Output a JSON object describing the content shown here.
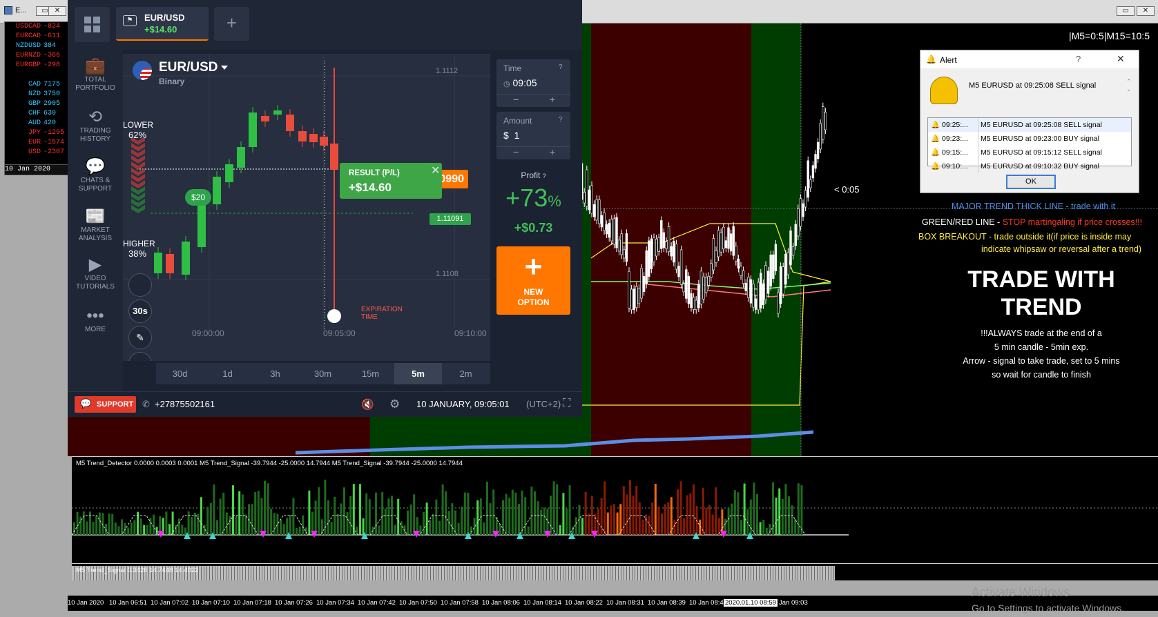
{
  "window": {
    "title": "E...",
    "minimize": "▭",
    "close": "✕"
  },
  "main_window": {
    "minimize": "▭",
    "close": "✕"
  },
  "market_watch": {
    "rows": [
      {
        "sym": "USDCAD",
        "val": "-824",
        "color": "#ff3030"
      },
      {
        "sym": "EURCAD",
        "val": "-611",
        "color": "#ff3030"
      },
      {
        "sym": "NZDUSD",
        "val": "384",
        "color": "#35c6ff"
      },
      {
        "sym": "EURNZD",
        "val": "-366",
        "color": "#ff3030"
      },
      {
        "sym": "EURGBP",
        "val": "-298",
        "color": "#ff3030"
      },
      {
        "sym": "",
        "val": "",
        "color": "#000000"
      },
      {
        "sym": "CAD",
        "val": "7175",
        "color": "#35c6ff"
      },
      {
        "sym": "NZD",
        "val": "3750",
        "color": "#35c6ff"
      },
      {
        "sym": "GBP",
        "val": "2905",
        "color": "#35c6ff"
      },
      {
        "sym": "CHF",
        "val": "630",
        "color": "#35c6ff"
      },
      {
        "sym": "AUD",
        "val": "420",
        "color": "#35c6ff"
      },
      {
        "sym": "JPY",
        "val": "-1295",
        "color": "#ff3030"
      },
      {
        "sym": "EUR",
        "val": "-1574",
        "color": "#ff3030"
      },
      {
        "sym": "USD",
        "val": "-2307",
        "color": "#ff3030"
      }
    ],
    "footer": "10 Jan 2020",
    "footer2": "10 Ja"
  },
  "chart": {
    "corner_text": "|M5=0:5|M15=10:5",
    "countdown": "< 0:05",
    "legend": [
      {
        "text": "MAJOR TREND THICK LINE  -  trade with it",
        "color": "#4f8fe6"
      },
      {
        "text": "GREEN/RED LINE - ",
        "color": "#ffffff"
      },
      {
        "text": "STOP martingaling if price crosses!!!",
        "color": "#ff3b1f"
      },
      {
        "text": "BOX BREAKOUT - trade outside it(if price is inside may",
        "color": "#ffee3a"
      },
      {
        "text": "indicate whipsaw or reversal after a trend)",
        "color": "#ffee3a"
      }
    ],
    "big_title_1": "TRADE WITH",
    "big_title_2": "TREND",
    "notes": [
      "!!!ALWAYS trade at the end of a",
      "5 min candle - 5min exp.",
      "Arrow - signal to take trade, set to 5 mins",
      "so wait for candle to finish"
    ],
    "indicator_label": "M5 Trend_Detector 0.0000 0.0003 0.0001  M5 Trend_Signal -39.7944 -25.0000 14.7944  M5 Trend_Signal -39.7944 -25.0000 14.7944",
    "indicator2_label": "M5 Trend_Signal 0.3426 14.7448 14.4022",
    "time_axis": [
      "10 Jan 2020",
      "10 Jan 06:51",
      "10 Jan 07:02",
      "10 Jan 07:10",
      "10 Jan 07:18",
      "10 Jan 07:26",
      "10 Jan 07:34",
      "10 Jan 07:42",
      "10 Jan 07:50",
      "10 Jan 07:58",
      "10 Jan 08:06",
      "10 Jan 08:14",
      "10 Jan 08:22",
      "10 Jan 08:31",
      "10 Jan 08:39",
      "10 Jan 08:47",
      "2020.01.10 08:59",
      "Jan 09:03"
    ],
    "watermark_1": "Activate Windows",
    "watermark_2": "Go to Settings to activate Windows."
  },
  "alert": {
    "title": "Alert",
    "help": "?",
    "close": "✕",
    "message": "M5 EURUSD at 09:25:08  SELL signal",
    "rows": [
      {
        "time": "09:25:...",
        "msg": "M5 EURUSD at 09:25:08  SELL signal"
      },
      {
        "time": "09:23:...",
        "msg": "M5 EURUSD at 09:23:00  BUY signal"
      },
      {
        "time": "09:15:...",
        "msg": "M5 EURUSD at 09:15:12  SELL signal"
      },
      {
        "time": "09:10:...",
        "msg": "M5 EURUSD at 09:10:32  BUY signal"
      }
    ],
    "ok": "OK"
  },
  "iq": {
    "tab_asset": "EUR/USD",
    "tab_pl": "+$14.60",
    "add_tab": "+",
    "sidebar": [
      {
        "label1": "TOTAL",
        "label2": "PORTFOLIO",
        "icon": "briefcase-icon"
      },
      {
        "label1": "TRADING",
        "label2": "HISTORY",
        "icon": "history-icon"
      },
      {
        "label1": "CHATS &",
        "label2": "SUPPORT",
        "icon": "chat-icon"
      },
      {
        "label1": "MARKET",
        "label2": "ANALYSIS",
        "icon": "news-icon"
      },
      {
        "label1": "VIDEO",
        "label2": "TUTORIALS",
        "icon": "play-icon"
      },
      {
        "label1": "MORE",
        "label2": "",
        "icon": "more-icon"
      }
    ],
    "asset": "EUR/USD",
    "asset_type": "Binary",
    "lower_label": "LOWER",
    "lower_pct": "62%",
    "higher_label": "HIGHER",
    "higher_pct": "38%",
    "price_ticks": [
      "1.1112",
      "1.1108"
    ],
    "current_price": "1.11091",
    "result_price": "1.10990",
    "result_price_visible": "0990",
    "result_label": "RESULT (P/L)",
    "result_value": "+$14.60",
    "bet_label": "$20",
    "time_ticks": [
      "09:00:00",
      "09:05:00",
      "09:10:00"
    ],
    "expiration_1": "EXPIRATION",
    "expiration_2": "TIME",
    "interval_btn": "30s",
    "timeframes": [
      "30d",
      "1d",
      "3h",
      "30m",
      "15m",
      "5m",
      "2m"
    ],
    "timeframe_active": "5m",
    "time_label": "Time",
    "time_value": "09:05",
    "amount_label": "Amount",
    "amount_currency": "$",
    "amount_value": "1",
    "minus": "−",
    "plus": "+",
    "profit_label": "Profit",
    "profit_pct": "+73",
    "profit_pct_sign": "%",
    "profit_value": "+$0.73",
    "new_option_1": "NEW",
    "new_option_2": "OPTION",
    "support": "SUPPORT",
    "phone": "+27875502161",
    "datetime": "10 JANUARY, 09:05:01",
    "tz": "(UTC+2)"
  }
}
